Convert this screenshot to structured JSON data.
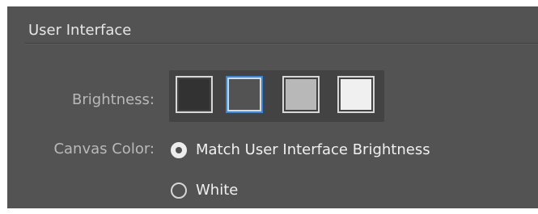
{
  "section": {
    "title": "User Interface"
  },
  "brightness": {
    "label": "Brightness:",
    "options": [
      {
        "name": "Dark",
        "color": "#323232",
        "selected": false
      },
      {
        "name": "Medium Dark",
        "color": "#535353",
        "selected": true
      },
      {
        "name": "Medium Light",
        "color": "#b8b8b8",
        "selected": false
      },
      {
        "name": "Light",
        "color": "#f0f0f0",
        "selected": false
      }
    ]
  },
  "canvas_color": {
    "label": "Canvas Color:",
    "options": [
      {
        "label": "Match User Interface Brightness",
        "checked": true
      },
      {
        "label": "White",
        "checked": false
      }
    ]
  },
  "colors": {
    "panel_background": "#535353",
    "accent_selection": "#2d8ceb",
    "text_primary": "#f0f0f0",
    "text_label": "#b9b9b9"
  }
}
